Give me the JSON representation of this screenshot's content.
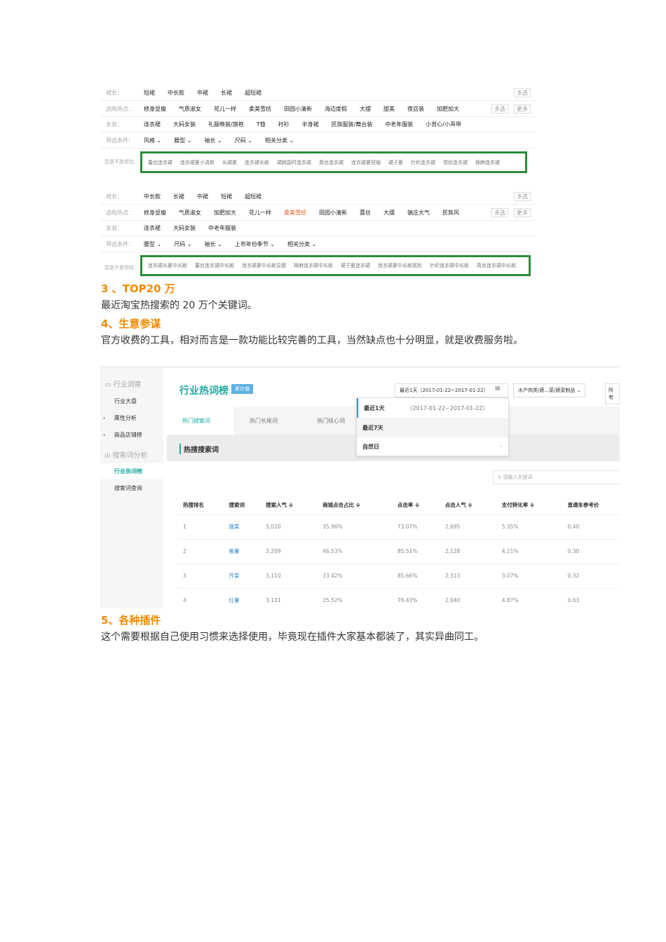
{
  "filter1": {
    "rows": [
      {
        "label": "裙长：",
        "items": [
          "短裙",
          "中长款",
          "中裙",
          "长裙",
          "超短裙"
        ],
        "right": [
          "多选"
        ]
      },
      {
        "label": "选购热点：",
        "items": [
          "修身显瘦",
          "气质淑女",
          "花儿一样",
          "柔美雪纺",
          "田园小清新",
          "海边度假",
          "大摆",
          "甜美",
          "夜店装",
          "加肥加大"
        ],
        "right": [
          "多选",
          "更多"
        ]
      },
      {
        "label": "女装：",
        "items": [
          "连衣裙",
          "大码女装",
          "礼服晚装/旗袍",
          "T恤",
          "衬衫",
          "半身裙",
          "民族服装/舞台装",
          "中老年服装",
          "小背心/小吊带"
        ],
        "right": []
      },
      {
        "label": "筛选条件：",
        "items": [
          "风格 ⌄",
          "腰型 ⌄",
          "袖长 ⌄",
          "尺码 ⌄",
          "相关分类 ⌄"
        ],
        "right": []
      }
    ],
    "suggest_label": "您是不是想找：",
    "suggest": [
      "蕾丝连衣裙",
      "连衣裙夏小清新",
      "长裙夏",
      "连衣裙长款",
      "裙韩国时连衣裙",
      "真丝连衣裙",
      "连衣裙夏短袖",
      "裙子夏",
      "针织连衣裙",
      "雪纺连衣裙",
      "棉麻连衣裙"
    ]
  },
  "filter2": {
    "rows": [
      {
        "label": "裙长：",
        "items": [
          "中长款",
          "长裙",
          "中裙",
          "短裙",
          "超短裙"
        ],
        "right": [
          "多选"
        ]
      },
      {
        "label": "选购热点：",
        "items": [
          "修身显瘦",
          "气质淑女",
          "加肥加大",
          "花儿一样",
          "柔美雪纺",
          "田园小清新",
          "蕾丝",
          "大摆",
          "端庄大气",
          "民族风"
        ],
        "right": [
          "多选",
          "更多"
        ]
      },
      {
        "label": "女装：",
        "items": [
          "连衣裙",
          "大码女装",
          "中老年服装"
        ],
        "right": []
      },
      {
        "label": "筛选条件：",
        "items": [
          "腰型 ⌄",
          "尺码 ⌄",
          "袖长 ⌄",
          "上市年份季节 ⌄",
          "相关分类 ⌄"
        ],
        "right": []
      }
    ],
    "suggest_label": "您是不是想找：",
    "suggest": [
      "连衣裙长夏中长款",
      "蕾丝连衣裙中长款",
      "连衣裙夏中长款显瘦",
      "棉麻连衣裙中长款",
      "裙子夏连衣裙",
      "连衣裙夏中长款宽松",
      "针织连衣裙中长款",
      "真丝连衣裙中长款"
    ]
  },
  "s3": {
    "title": "3 、TOP20 万",
    "text": "最近淘宝热搜索的 20 万个关键词。"
  },
  "s4": {
    "title": "4、生意参谋",
    "text": "官方收费的工具，相对而言是一款功能比较完善的工具，当然缺点也十分明显，就是收费服务啦。"
  },
  "s5": {
    "title": "5、各种插件",
    "text": "这个需要根据自己使用习惯来选择使用，毕竟现在插件大家基本都装了，其实异曲同工。"
  },
  "biz": {
    "side": {
      "group1": "行业洞察",
      "items1": [
        "行业大盘",
        "属性分析",
        "商品店铺榜"
      ],
      "group2": "搜索词分析",
      "items2": [
        "行业热词榜",
        "搜索词查询"
      ]
    },
    "title": "行业热词榜",
    "badge": "累计值",
    "date": "最近1天（2017-01-22~2017-01-22）",
    "category": "水产肉类/蔬...菜/蔬菜制品 ⌄",
    "all": "所有",
    "tabs": [
      "热门搜索词",
      "热门长尾词",
      "热门核心词"
    ],
    "section": "热搜搜索词",
    "dropdown": [
      {
        "label": "最近1天",
        "range": "（2017-01-22~2017-01-22）"
      },
      {
        "label": "最近7天",
        "range": ""
      },
      {
        "label": "自然日",
        "range": "›"
      }
    ],
    "search_placeholder": "请输入关键词",
    "columns": [
      "热搜排名",
      "搜索词",
      "搜索人气 ≑",
      "商城点击占比 ≑",
      "点击率 ≑",
      "点击人气 ≑",
      "支付转化率 ≑",
      "直通车参考价"
    ],
    "rows": [
      [
        "1",
        "蔬菜",
        "5,020",
        "35.96%",
        "73.07%",
        "2,695",
        "5.35%",
        "0.40"
      ],
      [
        "2",
        "紫薯",
        "3,209",
        "46.53%",
        "85.51%",
        "2,128",
        "4.21%",
        "0.30"
      ],
      [
        "3",
        "芥菜",
        "3,110",
        "33.42%",
        "85.66%",
        "2,313",
        "3.07%",
        "0.32"
      ],
      [
        "4",
        "红薯",
        "3,101",
        "25.52%",
        "78.43%",
        "2,040",
        "4.87%",
        "0.63"
      ]
    ]
  },
  "colors": {
    "heading": "#f08a00",
    "green_box": "#2e8b3a",
    "accent": "#1fa9a1"
  }
}
